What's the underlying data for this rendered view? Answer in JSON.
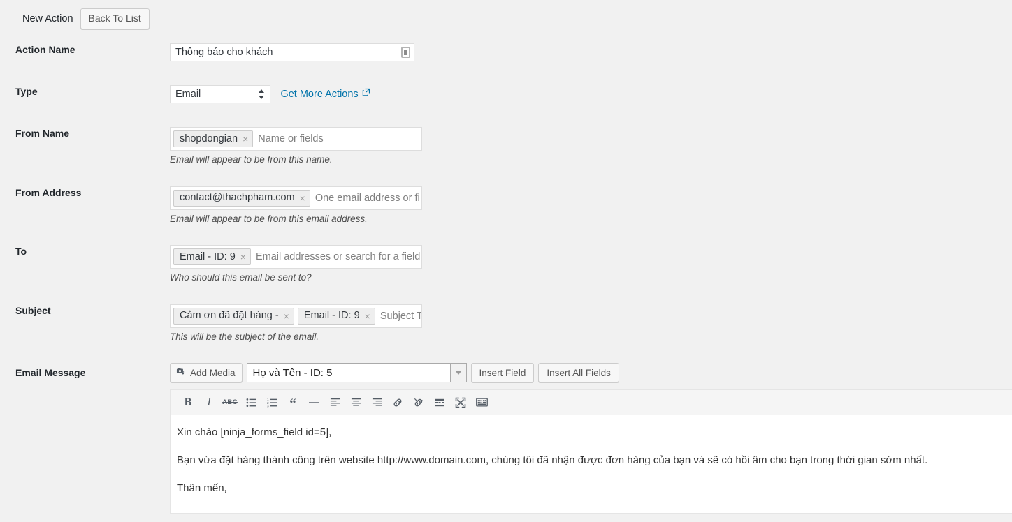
{
  "header": {
    "title": "New Action",
    "back_button": "Back To List"
  },
  "fields": {
    "action_name": {
      "label": "Action Name",
      "value": "Thông báo cho khách",
      "merge_icon": "merge-tag-icon"
    },
    "type": {
      "label": "Type",
      "selected": "Email",
      "link_label": "Get More Actions",
      "link_icon": "external-link-icon"
    },
    "from_name": {
      "label": "From Name",
      "chips": [
        "shopdongian"
      ],
      "placeholder": "Name or fields",
      "help": "Email will appear to be from this name."
    },
    "from_address": {
      "label": "From Address",
      "chips": [
        "contact@thachpham.com"
      ],
      "placeholder": "One email address or fi",
      "help": "Email will appear to be from this email address."
    },
    "to": {
      "label": "To",
      "chips": [
        "Email - ID: 9"
      ],
      "placeholder": "Email addresses or search for a field",
      "help": "Who should this email be sent to?"
    },
    "subject": {
      "label": "Subject",
      "chips": [
        "Cảm ơn đã đặt hàng -",
        "Email - ID: 9"
      ],
      "placeholder": "Subject Te",
      "help": "This will be the subject of the email."
    },
    "email_message": {
      "label": "Email Message",
      "add_media": "Add Media",
      "add_media_icon": "media-icon",
      "field_select_value": "Họ và Tên - ID: 5",
      "field_select_caret_icon": "chevron-down-icon",
      "insert_field": "Insert Field",
      "insert_all_fields": "Insert All Fields"
    }
  },
  "toolbar": [
    {
      "name": "bold-icon",
      "glyph": "B"
    },
    {
      "name": "italic-icon",
      "glyph": "I"
    },
    {
      "name": "strikethrough-icon",
      "glyph": "ABC"
    },
    {
      "name": "bulleted-list-icon",
      "glyph": ""
    },
    {
      "name": "numbered-list-icon",
      "glyph": ""
    },
    {
      "name": "blockquote-icon",
      "glyph": "“"
    },
    {
      "name": "horizontal-rule-icon",
      "glyph": ""
    },
    {
      "name": "align-left-icon",
      "glyph": ""
    },
    {
      "name": "align-center-icon",
      "glyph": ""
    },
    {
      "name": "align-right-icon",
      "glyph": ""
    },
    {
      "name": "insert-link-icon",
      "glyph": ""
    },
    {
      "name": "remove-link-icon",
      "glyph": ""
    },
    {
      "name": "insert-read-more-icon",
      "glyph": ""
    },
    {
      "name": "fullscreen-icon",
      "glyph": ""
    },
    {
      "name": "keyboard-shortcuts-icon",
      "glyph": ""
    }
  ],
  "message_body": [
    "Xin chào [ninja_forms_field id=5],",
    "Bạn vừa đặt hàng thành công trên website http://www.domain.com, chúng tôi đã nhận được đơn hàng của bạn và sẽ có hồi âm cho bạn trong thời gian sớm nhất.",
    "Thân mến,"
  ],
  "colors": {
    "page_bg": "#f1f1f1",
    "link": "#0073aa",
    "text": "#23282d",
    "chip_bg": "#eeeeee",
    "icon": "#555d66"
  }
}
